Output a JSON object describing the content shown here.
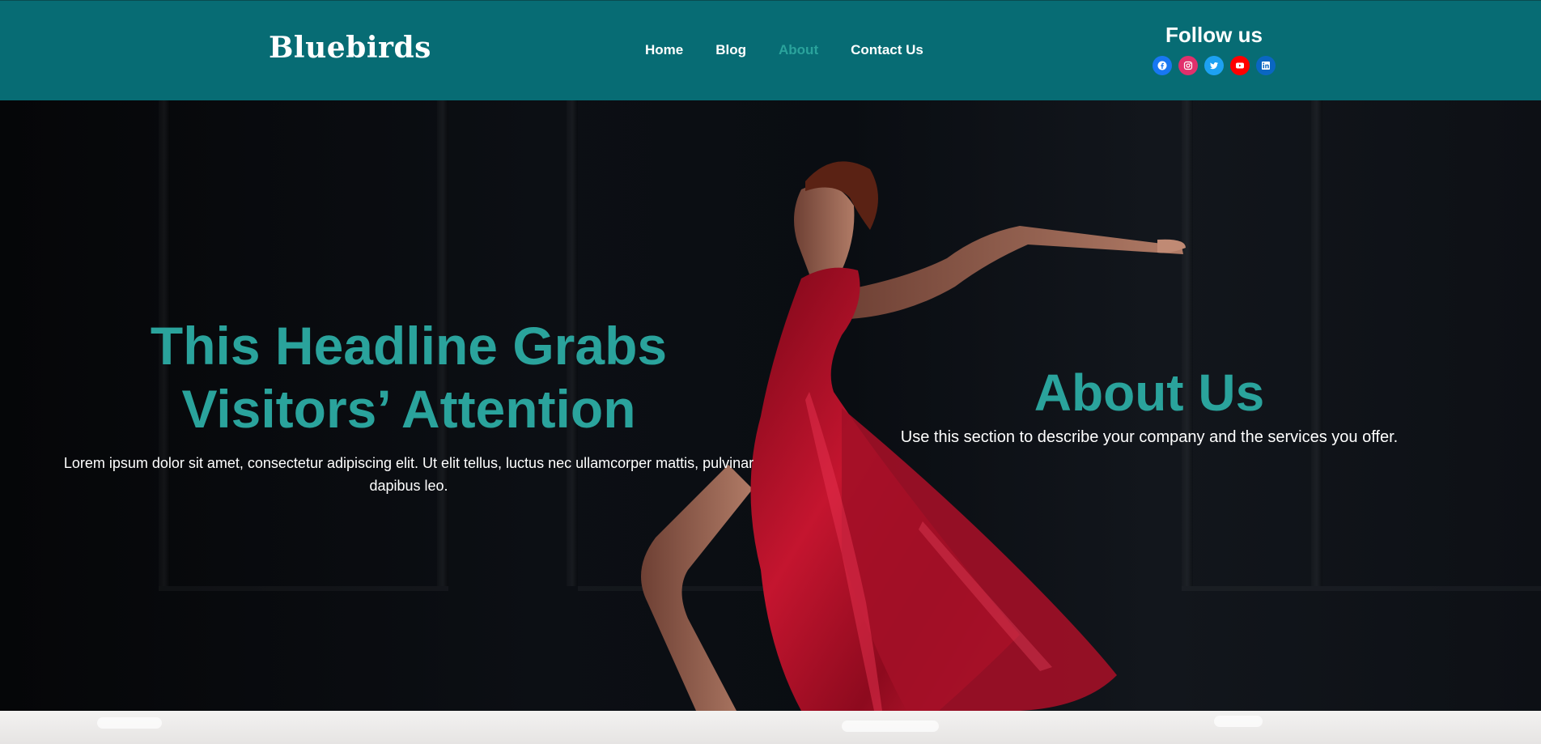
{
  "header": {
    "logo": "Bluebirds",
    "nav": [
      {
        "label": "Home",
        "active": false
      },
      {
        "label": "Blog",
        "active": false
      },
      {
        "label": "About",
        "active": true
      },
      {
        "label": "Contact Us",
        "active": false
      }
    ],
    "follow": {
      "title": "Follow us",
      "socials": [
        {
          "icon": "facebook-icon",
          "color": "#1877f2"
        },
        {
          "icon": "instagram-icon",
          "color": "#e1306c"
        },
        {
          "icon": "twitter-icon",
          "color": "#1da1f2"
        },
        {
          "icon": "youtube-icon",
          "color": "#ff0000"
        },
        {
          "icon": "linkedin-icon",
          "color": "#0a66c2"
        }
      ]
    }
  },
  "hero": {
    "headline": "This Headline Grabs Visitors’ Attention",
    "lead": "Lorem ipsum dolor sit amet, consectetur adipiscing elit. Ut elit tellus, luctus nec ullamcorper mattis, pulvinar dapibus leo.",
    "about_title": "About Us",
    "about_text": "Use this section to describe your company and the services you offer."
  },
  "colors": {
    "header_bg": "#076c74",
    "accent": "#2aa39c",
    "dress": "#b0112c"
  }
}
